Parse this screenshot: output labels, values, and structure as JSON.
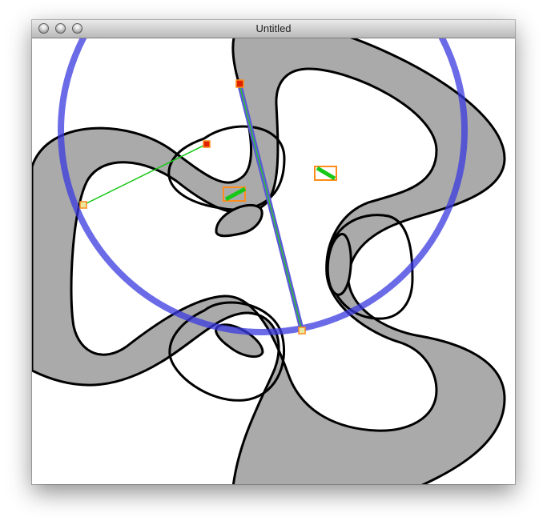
{
  "window": {
    "title": "Untitled",
    "buttons": [
      "close",
      "minimize",
      "zoom"
    ]
  },
  "colors": {
    "shape_fill": "#aaaaaa",
    "shape_stroke": "#000000",
    "circle": "#4a4ae6",
    "segment": "#2ac92a",
    "marker_box": "#ff8c1a",
    "handle_red": "#dd2200"
  },
  "icons": [
    "close-button-icon",
    "minimize-button-icon",
    "zoom-button-icon"
  ]
}
